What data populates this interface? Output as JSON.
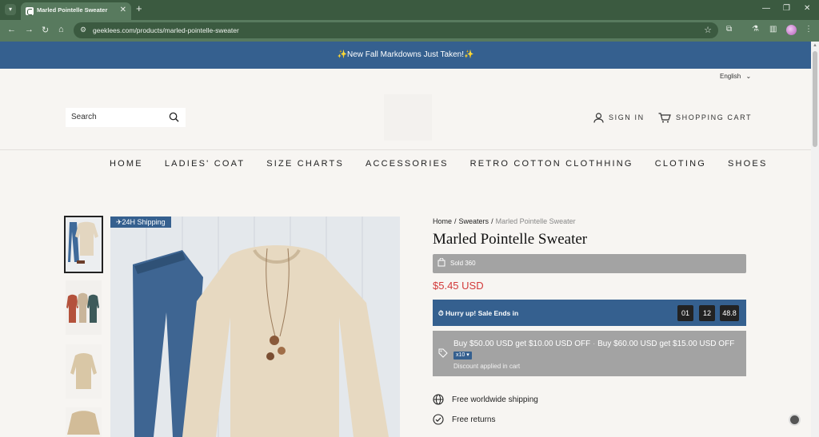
{
  "browser": {
    "tab": {
      "title": "Marled Pointelle Sweater"
    },
    "url": "geeklees.com/products/marled-pointelle-sweater"
  },
  "announcement": "✨New Fall Markdowns Just Taken!✨",
  "header": {
    "language": "English",
    "search_placeholder": "Search",
    "sign_in": "SIGN IN",
    "cart": "SHOPPING CART"
  },
  "nav": {
    "items": [
      "HOME",
      "LADIES' COAT",
      "SIZE CHARTS",
      "ACCESSORIES",
      "RETRO COTTON CLOTHHING",
      "CLOTING",
      "SHOES"
    ]
  },
  "gallery": {
    "badge": "✈24H Shipping"
  },
  "product": {
    "breadcrumb": {
      "home": "Home",
      "category": "Sweaters",
      "current": "Marled Pointelle Sweater"
    },
    "title": "Marled Pointelle Sweater",
    "sold": "Sold 360",
    "price": "$5.45 USD",
    "timer": {
      "label": "Hurry up! Sale Ends in",
      "h": "01",
      "m": "12",
      "s": "48.8"
    },
    "discount": {
      "offer1": "Buy $50.00 USD get $10.00 USD OFF",
      "offer2": "Buy $60.00 USD get $15.00 USD OFF",
      "multiplier": "x10",
      "note": "Discount applied in cart"
    },
    "features": [
      "Free worldwide shipping",
      "Free returns"
    ]
  },
  "colors": {
    "accent": "#35608f",
    "price": "#d23a3a",
    "chrome": "#3b5a40"
  }
}
